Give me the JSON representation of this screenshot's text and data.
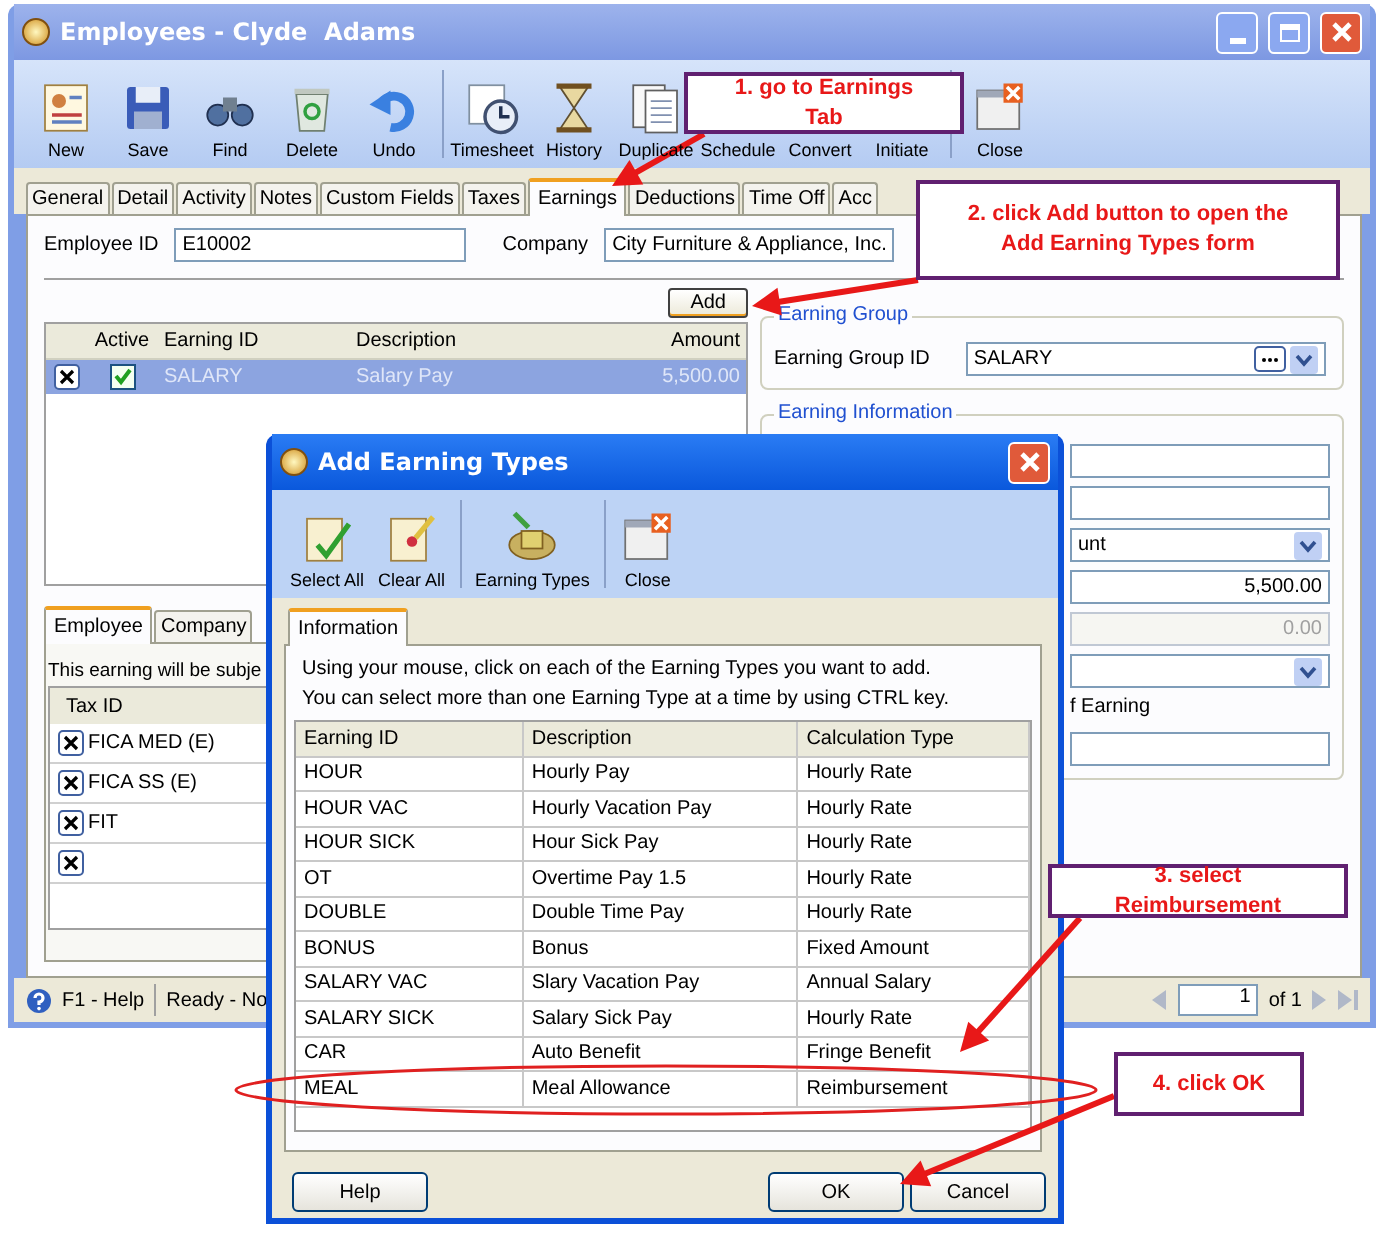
{
  "window": {
    "title": "Employees - Clyde  Adams"
  },
  "toolbar": [
    {
      "label": "New",
      "kind": "form"
    },
    {
      "label": "Save",
      "kind": "disk"
    },
    {
      "label": "Find",
      "kind": "binoculars"
    },
    {
      "label": "Delete",
      "kind": "bin"
    },
    {
      "label": "Undo",
      "kind": "undo"
    },
    {
      "label": "Timesheet",
      "kind": "clock"
    },
    {
      "label": "History",
      "kind": "hourglass"
    },
    {
      "label": "Duplicate",
      "kind": "documents"
    },
    {
      "label": "Schedule",
      "kind": "covered"
    },
    {
      "label": "Convert",
      "kind": "covered"
    },
    {
      "label": "Initiate",
      "kind": "covered"
    },
    {
      "label": "Close",
      "kind": "close-window"
    }
  ],
  "tabs": [
    {
      "label": "General",
      "selected": false
    },
    {
      "label": "Detail",
      "selected": false
    },
    {
      "label": "Activity",
      "selected": false
    },
    {
      "label": "Notes",
      "selected": false
    },
    {
      "label": "Custom Fields",
      "selected": false
    },
    {
      "label": "Taxes",
      "selected": false
    },
    {
      "label": "Earnings",
      "selected": true
    },
    {
      "label": "Deductions",
      "selected": false
    },
    {
      "label": "Time Off",
      "selected": false
    },
    {
      "label": "Acc",
      "selected": false
    }
  ],
  "employee": {
    "id_label": "Employee ID",
    "id_value": "E10002",
    "company_label": "Company",
    "company_value": "City Furniture & Appliance, Inc."
  },
  "add_button": "Add",
  "earnings_table": {
    "columns": [
      "Active",
      "Earning ID",
      "Description",
      "Amount"
    ],
    "rows": [
      {
        "active": true,
        "earning_id": "SALARY",
        "description": "Salary Pay",
        "amount": "5,500.00",
        "selected": true
      }
    ]
  },
  "lower_tabs": [
    {
      "label": "Employee",
      "selected": true
    },
    {
      "label": "Company",
      "selected": false
    }
  ],
  "subject_text": "This earning will be subje",
  "tax_table": {
    "columns": [
      "Tax ID"
    ],
    "rows": [
      {
        "tax_id": "FICA MED (E)"
      },
      {
        "tax_id": "FICA SS (E)"
      },
      {
        "tax_id": "FIT"
      },
      {}
    ]
  },
  "earning_group": {
    "title": "Earning Group",
    "label": "Earning Group ID",
    "value": "SALARY"
  },
  "earning_information": {
    "title": "Earning Information",
    "rows": [
      {
        "kind": "field",
        "disabled": false
      },
      {
        "kind": "field",
        "disabled": false
      },
      {
        "kind": "dropdown",
        "value": "unt",
        "disabled": false
      },
      {
        "kind": "number",
        "value": "5,500.00",
        "disabled": false
      },
      {
        "kind": "number",
        "value": "0.00",
        "disabled": true
      },
      {
        "kind": "dropdown",
        "disabled": false
      },
      {
        "kind": "label",
        "value": "f Earning",
        "disabled": false
      },
      {
        "kind": "field",
        "disabled": false
      }
    ]
  },
  "status_bar": {
    "help": "F1 - Help",
    "status": "Ready - No",
    "page": "1",
    "of": "of 1"
  },
  "dialog": {
    "title": "Add Earning Types",
    "toolbar": [
      {
        "label": "Select All",
        "kind": "clipboard-check"
      },
      {
        "label": "Clear All",
        "kind": "clipboard"
      },
      {
        "label": "Earning Types",
        "kind": "money"
      },
      {
        "label": "Close",
        "kind": "close-window"
      }
    ],
    "tab": "Information",
    "instructions": [
      "Using your mouse, click on each of the Earning Types you want to add.",
      "You can select more than one Earning Type at a time by using CTRL key."
    ],
    "columns": [
      "Earning ID",
      "Description",
      "Calculation Type"
    ],
    "rows": [
      {
        "earning_id": "HOUR",
        "description": "Hourly Pay",
        "calculation_type": "Hourly Rate",
        "selected": false
      },
      {
        "earning_id": "HOUR VAC",
        "description": "Hourly Vacation Pay",
        "calculation_type": "Hourly Rate",
        "selected": false
      },
      {
        "earning_id": "HOUR SICK",
        "description": "Hour Sick Pay",
        "calculation_type": "Hourly Rate",
        "selected": false
      },
      {
        "earning_id": "OT",
        "description": "Overtime Pay 1.5",
        "calculation_type": "Hourly Rate",
        "selected": false
      },
      {
        "earning_id": "DOUBLE",
        "description": "Double Time Pay",
        "calculation_type": "Hourly Rate",
        "selected": false
      },
      {
        "earning_id": "BONUS",
        "description": "Bonus",
        "calculation_type": "Fixed Amount",
        "selected": false
      },
      {
        "earning_id": "SALARY VAC",
        "description": "Slary Vacation Pay",
        "calculation_type": "Annual Salary",
        "selected": false
      },
      {
        "earning_id": "SALARY SICK",
        "description": "Salary Sick Pay",
        "calculation_type": "Hourly Rate",
        "selected": false
      },
      {
        "earning_id": "CAR",
        "description": "Auto Benefit",
        "calculation_type": "Fringe Benefit",
        "selected": false
      },
      {
        "earning_id": "MEAL",
        "description": "Meal Allowance",
        "calculation_type": "Reimbursement",
        "selected": false
      }
    ],
    "buttons": [
      "Help",
      "OK",
      "Cancel"
    ]
  },
  "callouts": [
    {
      "text": "1. go to Earnings Tab"
    },
    {
      "text": "2.  click Add button to open the Add Earning Types form"
    },
    {
      "text": "3.  select Reimbursement"
    },
    {
      "text": "4.  click OK"
    }
  ]
}
